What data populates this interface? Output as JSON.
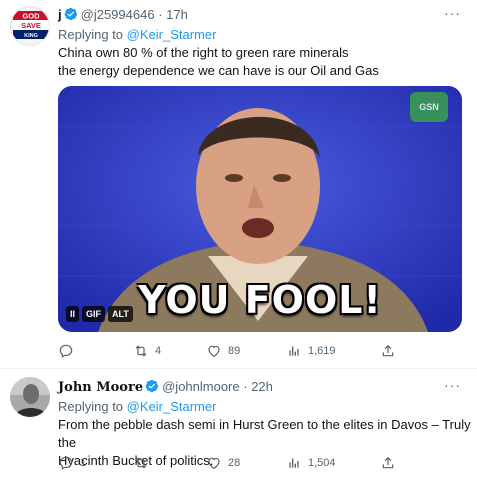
{
  "tweets": [
    {
      "name": "j",
      "handle": "@j25994646",
      "time": "· 17h",
      "more": "···",
      "reply_prefix": "Replying to",
      "reply_to": "@Keir_Starmer",
      "text_line1": "China own 80 % of the right to green rare minerals",
      "text_line2": "the energy dependence we can have is our Oil and Gas",
      "avatar_text": [
        "GOD",
        "SAVE",
        "THE",
        "KING"
      ],
      "media": {
        "caption": "YOU FOOL!",
        "gif_label": "GIF",
        "alt_label": "ALT",
        "pause_label": "II",
        "watermark": "GSN"
      },
      "actions": {
        "replies": "",
        "retweets": "4",
        "likes": "89",
        "views": "1,619"
      }
    },
    {
      "name": "John Moore",
      "handle": "@johnlmoore",
      "time": "· 22h",
      "more": "···",
      "reply_prefix": "Replying to",
      "reply_to": "@Keir_Starmer",
      "text_line1": "From the pebble dash semi in Hurst Green to the elites in Davos – Truly the",
      "text_line2": "Hyacinth Bucket of politics.",
      "actions": {
        "replies": "1",
        "retweets": "",
        "likes": "28",
        "views": "1,504"
      }
    }
  ],
  "colors": {
    "accent": "#1d9bf0",
    "verified": "#1d9bf0",
    "muted": "#536471",
    "gif_bg": "#2a36c4"
  }
}
